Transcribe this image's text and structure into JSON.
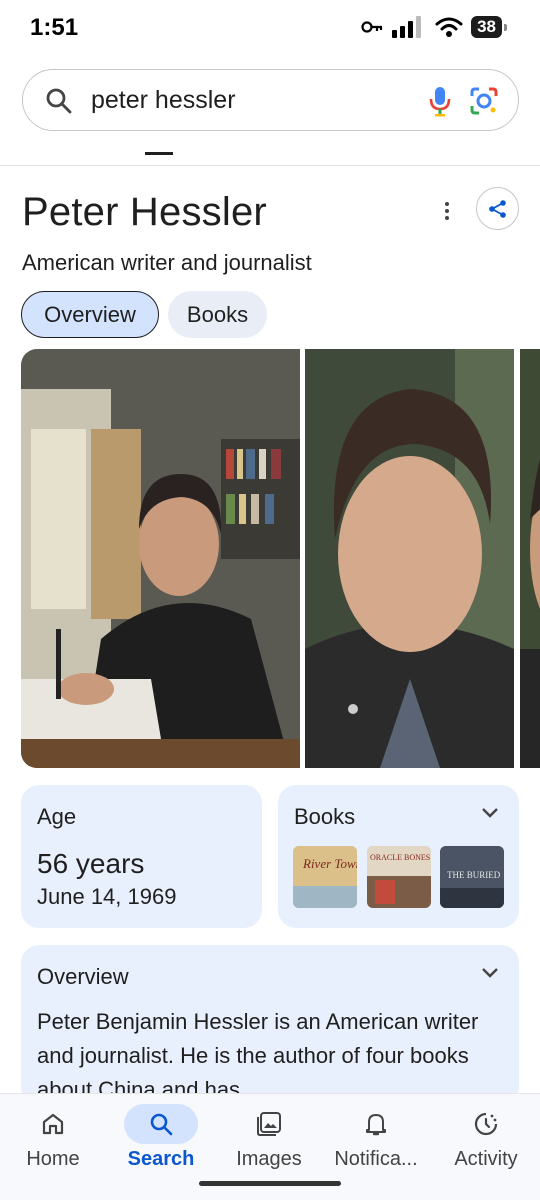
{
  "status_bar": {
    "time": "1:51",
    "battery": "38"
  },
  "search": {
    "query": "peter hessler"
  },
  "knowledge_panel": {
    "title": "Peter Hessler",
    "subtitle": "American writer and journalist",
    "chips": [
      {
        "label": "Overview",
        "selected": true
      },
      {
        "label": "Books",
        "selected": false
      }
    ],
    "age_card": {
      "label": "Age",
      "value": "56 years",
      "date": "June 14, 1969"
    },
    "books_card": {
      "label": "Books",
      "covers": [
        {
          "title": "River Town",
          "color": "#d9b874"
        },
        {
          "title": "ORACLE BONES",
          "color": "#c9b9a2"
        },
        {
          "title": "THE BURIED",
          "color": "#4b5565"
        }
      ]
    },
    "overview_card": {
      "label": "Overview",
      "text": "Peter Benjamin Hessler is an American writer and journalist. He is the author of four books about China and has"
    }
  },
  "bottom_nav": {
    "items": [
      {
        "label": "Home",
        "icon": "home-icon"
      },
      {
        "label": "Search",
        "icon": "search-icon",
        "selected": true
      },
      {
        "label": "Images",
        "icon": "images-icon"
      },
      {
        "label": "Notifica...",
        "icon": "bell-icon"
      },
      {
        "label": "Activity",
        "icon": "activity-icon"
      }
    ]
  },
  "colors": {
    "accent": "#0b57d0",
    "chip_bg": "#d3e3fd",
    "card_bg": "#e8f0fe"
  }
}
